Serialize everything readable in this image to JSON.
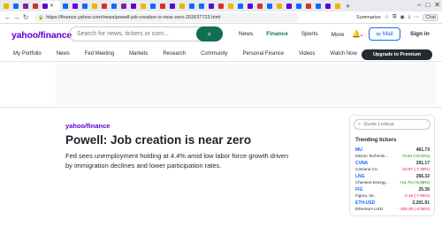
{
  "browser": {
    "url": "https://finance.yahoo.com/news/powell-job-creation-is-near-zero-202637723.html",
    "summarize_label": "Summarize",
    "chat_label": "Chat",
    "tab_colors": [
      "#f0b400",
      "#0f69ff",
      "#7b1fa2",
      "#d93025",
      "#6001d2",
      "#0f69ff",
      "#6001d2",
      "#0f69ff",
      "#f0b400",
      "#d93025",
      "#0f69ff",
      "#7b1fa2",
      "#6001d2",
      "#f0b400",
      "#0f69ff",
      "#d93025",
      "#6001d2",
      "#f0b400",
      "#0f69ff",
      "#0f69ff",
      "#6001d2",
      "#d93025",
      "#f0b400",
      "#0f69ff",
      "#6001d2",
      "#d93025",
      "#0f69ff",
      "#f0b400",
      "#6001d2",
      "#0f69ff",
      "#d93025",
      "#0f69ff",
      "#6001d2",
      "#f0b400"
    ]
  },
  "header": {
    "logo": "yahoo/finance",
    "search_placeholder": "Search for news, tickers or com...",
    "links": [
      "News",
      "Finance",
      "Sports",
      "More"
    ],
    "mail_label": "Mail",
    "signin_label": "Sign in"
  },
  "subnav": {
    "items": [
      "My Portfolio",
      "News",
      "Fed Meeting",
      "Markets",
      "Research",
      "Community",
      "Personal Finance",
      "Videos",
      "Watch Now"
    ],
    "premium_label": "Upgrade to Premium"
  },
  "article": {
    "logo": "yahoo/finance",
    "title": "Powell: Job creation is near zero",
    "subtitle": "Fed sees unemployment holding at 4.4% amid low labor force growth driven by immigration declines and lower participation rates."
  },
  "sidebar": {
    "quote_placeholder": "Quote Lookup",
    "trending_title": "Trending tickers",
    "tickers": [
      {
        "symbol": "MU",
        "name": "Micron Technolo...",
        "price": "461.73",
        "change": "+0.04 (+0.01%)",
        "direction": "up"
      },
      {
        "symbol": "CVNA",
        "name": "Carvana Co.",
        "price": "291.17",
        "change": "-23.57 (-7.49%)",
        "direction": "down"
      },
      {
        "symbol": "LNG",
        "name": "Cheniere Energy...",
        "price": "266.32",
        "change": "+14.73 (+5.85%)",
        "direction": "up"
      },
      {
        "symbol": "FIG",
        "name": "Figma, Inc.",
        "price": "25.36",
        "change": "-2.16 (-7.86%)",
        "direction": "down"
      },
      {
        "symbol": "ETH-USD",
        "name": "Ethereum USD",
        "price": "2,201.91",
        "change": "-105.30 (-4.56%)",
        "direction": "down"
      }
    ]
  }
}
